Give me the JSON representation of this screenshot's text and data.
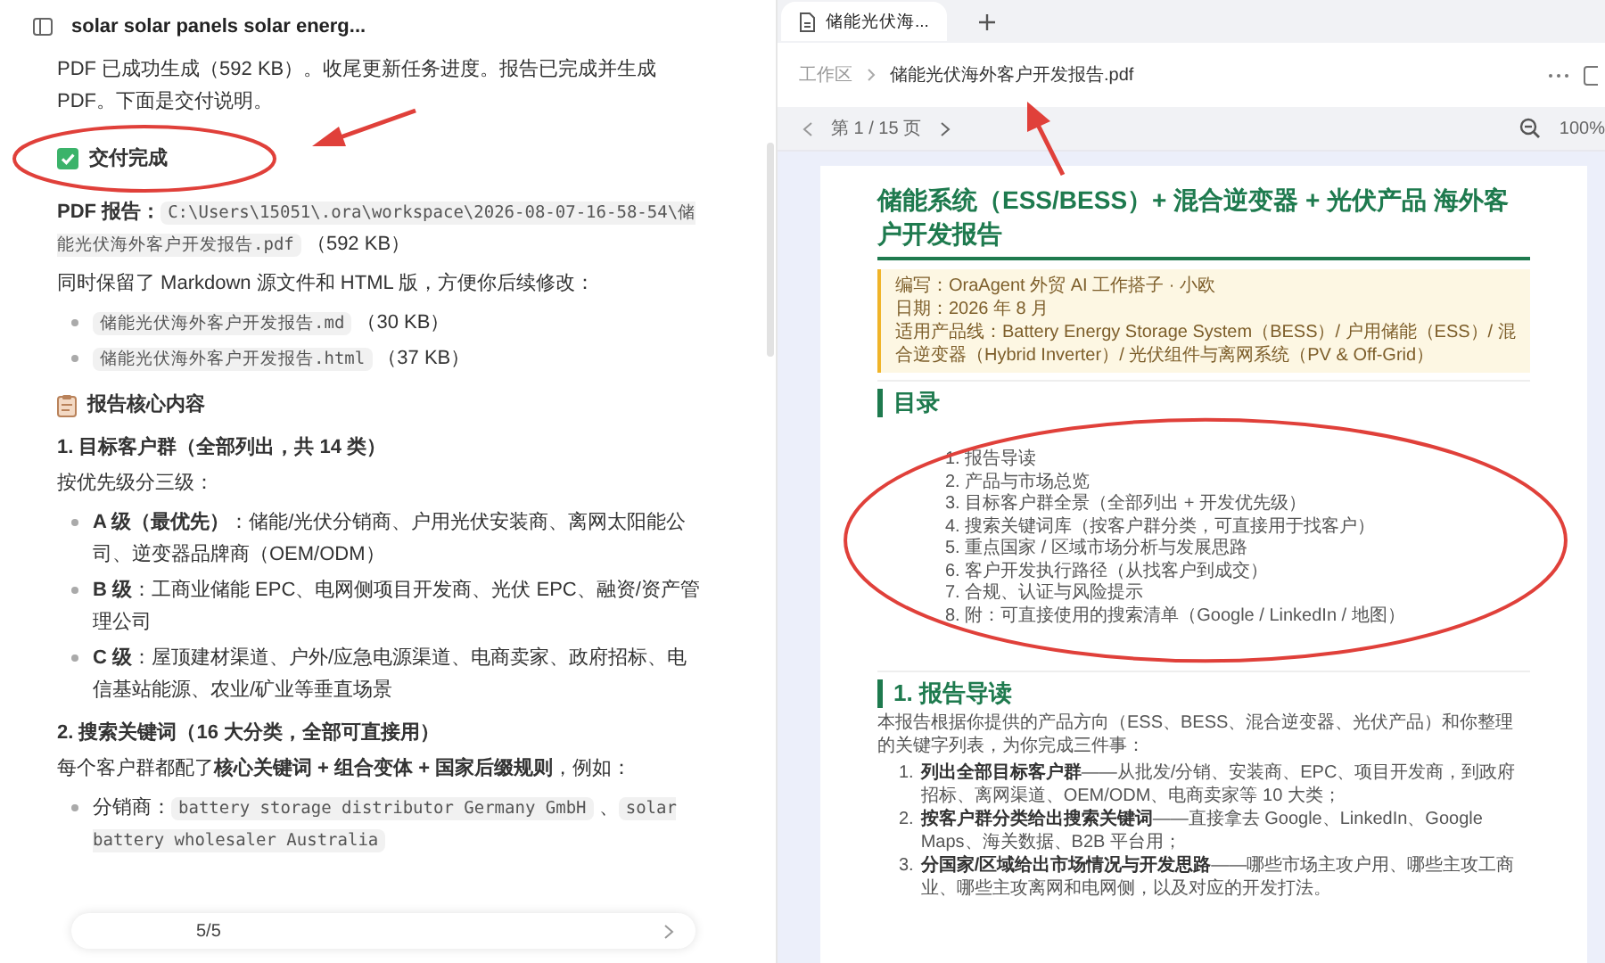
{
  "chat": {
    "title": "solar solar panels solar energ...",
    "blocks": [
      {
        "kind": "paragraph",
        "parts": [
          {
            "kind": "plain",
            "text": "PDF 已成功生成（592 KB）。收尾更新任务进度。报告已完成并生成 PDF。下面是交付说明。"
          }
        ]
      },
      {
        "kind": "check_heading",
        "text": "交付完成"
      },
      {
        "kind": "paragraph",
        "parts": [
          {
            "kind": "bold",
            "text": "PDF 报告："
          },
          {
            "kind": "code",
            "text": "C:\\Users\\15051\\.ora\\workspace\\2026-08-07-16-58-54\\储能光伏海外客户开发报告.pdf"
          },
          {
            "kind": "plain",
            "text": " （592 KB）"
          }
        ]
      },
      {
        "kind": "paragraph",
        "parts": [
          {
            "kind": "plain",
            "text": "同时保留了 Markdown 源文件和 HTML 版，方便你后续修改："
          }
        ]
      },
      {
        "kind": "list",
        "items": [
          {
            "parts": [
              {
                "kind": "code",
                "text": "储能光伏海外客户开发报告.md"
              },
              {
                "kind": "plain",
                "text": " （30 KB）"
              }
            ]
          },
          {
            "parts": [
              {
                "kind": "code",
                "text": "储能光伏海外客户开发报告.html"
              },
              {
                "kind": "plain",
                "text": " （37 KB）"
              }
            ]
          }
        ]
      },
      {
        "kind": "clipboard_heading",
        "text": "报告核心内容"
      },
      {
        "kind": "subheading",
        "text": "1. 目标客户群（全部列出，共 14 类）"
      },
      {
        "kind": "paragraph",
        "parts": [
          {
            "kind": "plain",
            "text": "按优先级分三级："
          }
        ]
      },
      {
        "kind": "list",
        "items": [
          {
            "parts": [
              {
                "kind": "bold",
                "text": "A 级（最优先）"
              },
              {
                "kind": "plain",
                "text": "：储能/光伏分销商、户用光伏安装商、离网太阳能公司、逆变器品牌商（OEM/ODM）"
              }
            ]
          },
          {
            "parts": [
              {
                "kind": "bold",
                "text": "B 级"
              },
              {
                "kind": "plain",
                "text": "：工商业储能 EPC、电网侧项目开发商、光伏 EPC、融资/资产管理公司"
              }
            ]
          },
          {
            "parts": [
              {
                "kind": "bold",
                "text": "C 级"
              },
              {
                "kind": "plain",
                "text": "：屋顶建材渠道、户外/应急电源渠道、电商卖家、政府招标、电信基站能源、农业/矿业等垂直场景"
              }
            ]
          }
        ]
      },
      {
        "kind": "subheading",
        "text": "2. 搜索关键词（16 大分类，全部可直接用）"
      },
      {
        "kind": "paragraph",
        "parts": [
          {
            "kind": "plain",
            "text": "每个客户群都配了"
          },
          {
            "kind": "bold",
            "text": "核心关键词 + 组合变体 + 国家后缀规则"
          },
          {
            "kind": "plain",
            "text": "，例如："
          }
        ]
      },
      {
        "kind": "list",
        "items": [
          {
            "parts": [
              {
                "kind": "plain",
                "text": "分销商："
              },
              {
                "kind": "code",
                "text": "battery storage distributor Germany GmbH"
              },
              {
                "kind": "plain",
                "text": " 、"
              },
              {
                "kind": "code",
                "text": "solar battery wholesaler Australia"
              }
            ]
          }
        ]
      }
    ],
    "progress": "5/5"
  },
  "viewer": {
    "tabs": [
      {
        "label": "储能光伏海...",
        "selected": true
      }
    ],
    "breadcrumb": [
      "工作区",
      "储能光伏海外客户开发报告.pdf"
    ],
    "pager": "第 1 / 15 页",
    "zoom": "100%",
    "document": {
      "title": "储能系统（ESS/BESS）+ 混合逆变器 + 光伏产品 海外客户开发报告",
      "meta": [
        "编写：OraAgent 外贸 AI 工作搭子 · 小欧",
        "日期：2026 年 8 月",
        "适用产品线：Battery Energy Storage System（BESS）/ 户用储能（ESS）/ 混合逆变器（Hybrid Inverter）/ 光伏组件与离网系统（PV & Off-Grid）"
      ],
      "toc_title": "目录",
      "toc": [
        "1. 报告导读",
        "2. 产品与市场总览",
        "3. 目标客户群全景（全部列出 + 开发优先级）",
        "4. 搜索关键词库（按客户群分类，可直接用于找客户）",
        "5. 重点国家 / 区域市场分析与发展思路",
        "6. 客户开发执行路径（从找客户到成交）",
        "7. 合规、认证与风险提示",
        "8. 附：可直接使用的搜索清单（Google / LinkedIn / 地图）"
      ],
      "section_title": "1. 报告导读",
      "intro": "本报告根据你提供的产品方向（ESS、BESS、混合逆变器、光伏产品）和你整理的关键字列表，为你完成三件事：",
      "points": [
        {
          "number": "1.",
          "bold": "列出全部目标客户群",
          "text": "——从批发/分销、安装商、EPC、项目开发商，到政府招标、离网渠道、OEM/ODM、电商卖家等 10 大类；"
        },
        {
          "number": "2.",
          "bold": "按客户群分类给出搜索关键词",
          "text": "——直接拿去 Google、LinkedIn、Google Maps、海关数据、B2B 平台用；"
        },
        {
          "number": "3.",
          "bold": "分国家/区域给出市场情况与开发思路",
          "text": "——哪些市场主攻户用、哪些主攻工商业、哪些主攻离网和电网侧，以及对应的开发打法。"
        }
      ]
    }
  }
}
